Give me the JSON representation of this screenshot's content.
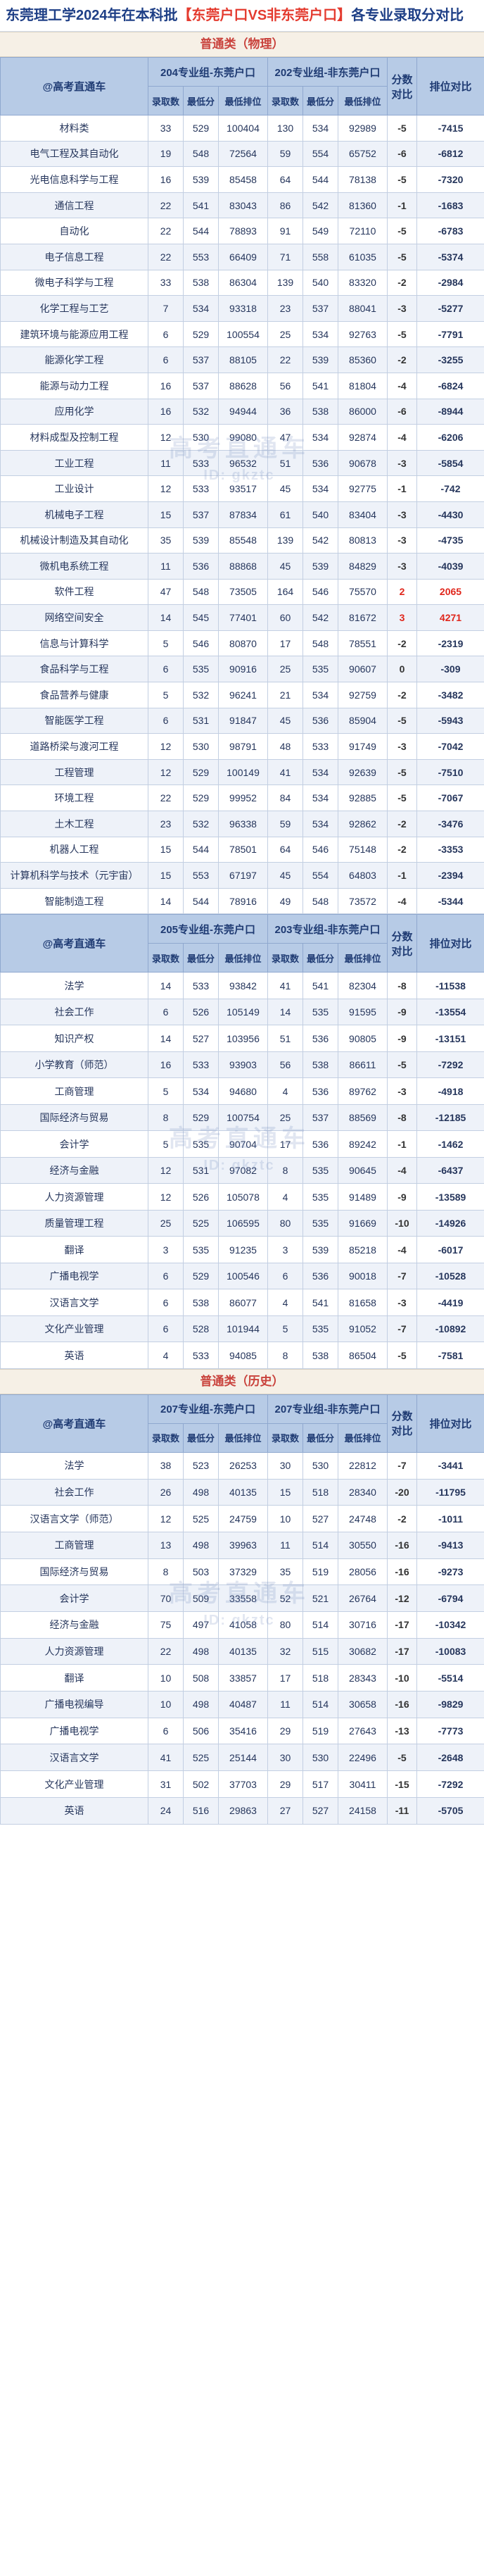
{
  "title": {
    "prefix": "东莞理工学2024年在本科批",
    "highlight": "【东莞户口VS非东莞户口】",
    "suffix": "各专业录取分对比"
  },
  "header_labels": {
    "author": "@高考直通车",
    "admit": "录取数",
    "min_score": "最低分",
    "min_rank": "最低排位",
    "score_diff": "分数对比",
    "rank_diff": "排位对比"
  },
  "watermark": {
    "text": "高考直通车",
    "sub": "ID: gkztc"
  },
  "sections": [
    {
      "title": "普通类（物理）",
      "group_dg": "204专业组-东莞户口",
      "group_ndg": "202专业组-非东莞户口",
      "rows": [
        {
          "name": "材料类",
          "a1": "33",
          "s1": "529",
          "r1": "100404",
          "a2": "130",
          "s2": "534",
          "r2": "92989",
          "d": "-5",
          "rd": "-7415"
        },
        {
          "name": "电气工程及其自动化",
          "a1": "19",
          "s1": "548",
          "r1": "72564",
          "a2": "59",
          "s2": "554",
          "r2": "65752",
          "d": "-6",
          "rd": "-6812"
        },
        {
          "name": "光电信息科学与工程",
          "a1": "16",
          "s1": "539",
          "r1": "85458",
          "a2": "64",
          "s2": "544",
          "r2": "78138",
          "d": "-5",
          "rd": "-7320"
        },
        {
          "name": "通信工程",
          "a1": "22",
          "s1": "541",
          "r1": "83043",
          "a2": "86",
          "s2": "542",
          "r2": "81360",
          "d": "-1",
          "rd": "-1683"
        },
        {
          "name": "自动化",
          "a1": "22",
          "s1": "544",
          "r1": "78893",
          "a2": "91",
          "s2": "549",
          "r2": "72110",
          "d": "-5",
          "rd": "-6783"
        },
        {
          "name": "电子信息工程",
          "a1": "22",
          "s1": "553",
          "r1": "66409",
          "a2": "71",
          "s2": "558",
          "r2": "61035",
          "d": "-5",
          "rd": "-5374"
        },
        {
          "name": "微电子科学与工程",
          "a1": "33",
          "s1": "538",
          "r1": "86304",
          "a2": "139",
          "s2": "540",
          "r2": "83320",
          "d": "-2",
          "rd": "-2984"
        },
        {
          "name": "化学工程与工艺",
          "a1": "7",
          "s1": "534",
          "r1": "93318",
          "a2": "23",
          "s2": "537",
          "r2": "88041",
          "d": "-3",
          "rd": "-5277"
        },
        {
          "name": "建筑环境与能源应用工程",
          "a1": "6",
          "s1": "529",
          "r1": "100554",
          "a2": "25",
          "s2": "534",
          "r2": "92763",
          "d": "-5",
          "rd": "-7791"
        },
        {
          "name": "能源化学工程",
          "a1": "6",
          "s1": "537",
          "r1": "88105",
          "a2": "22",
          "s2": "539",
          "r2": "85360",
          "d": "-2",
          "rd": "-3255"
        },
        {
          "name": "能源与动力工程",
          "a1": "16",
          "s1": "537",
          "r1": "88628",
          "a2": "56",
          "s2": "541",
          "r2": "81804",
          "d": "-4",
          "rd": "-6824"
        },
        {
          "name": "应用化学",
          "a1": "16",
          "s1": "532",
          "r1": "94944",
          "a2": "36",
          "s2": "538",
          "r2": "86000",
          "d": "-6",
          "rd": "-8944"
        },
        {
          "name": "材料成型及控制工程",
          "a1": "12",
          "s1": "530",
          "r1": "99080",
          "a2": "47",
          "s2": "534",
          "r2": "92874",
          "d": "-4",
          "rd": "-6206"
        },
        {
          "name": "工业工程",
          "a1": "11",
          "s1": "533",
          "r1": "96532",
          "a2": "51",
          "s2": "536",
          "r2": "90678",
          "d": "-3",
          "rd": "-5854"
        },
        {
          "name": "工业设计",
          "a1": "12",
          "s1": "533",
          "r1": "93517",
          "a2": "45",
          "s2": "534",
          "r2": "92775",
          "d": "-1",
          "rd": "-742"
        },
        {
          "name": "机械电子工程",
          "a1": "15",
          "s1": "537",
          "r1": "87834",
          "a2": "61",
          "s2": "540",
          "r2": "83404",
          "d": "-3",
          "rd": "-4430"
        },
        {
          "name": "机械设计制造及其自动化",
          "a1": "35",
          "s1": "539",
          "r1": "85548",
          "a2": "139",
          "s2": "542",
          "r2": "80813",
          "d": "-3",
          "rd": "-4735"
        },
        {
          "name": "微机电系统工程",
          "a1": "11",
          "s1": "536",
          "r1": "88868",
          "a2": "45",
          "s2": "539",
          "r2": "84829",
          "d": "-3",
          "rd": "-4039"
        },
        {
          "name": "软件工程",
          "a1": "47",
          "s1": "548",
          "r1": "73505",
          "a2": "164",
          "s2": "546",
          "r2": "75570",
          "d": "2",
          "rd": "2065"
        },
        {
          "name": "网络空间安全",
          "a1": "14",
          "s1": "545",
          "r1": "77401",
          "a2": "60",
          "s2": "542",
          "r2": "81672",
          "d": "3",
          "rd": "4271"
        },
        {
          "name": "信息与计算科学",
          "a1": "5",
          "s1": "546",
          "r1": "80870",
          "a2": "17",
          "s2": "548",
          "r2": "78551",
          "d": "-2",
          "rd": "-2319"
        },
        {
          "name": "食品科学与工程",
          "a1": "6",
          "s1": "535",
          "r1": "90916",
          "a2": "25",
          "s2": "535",
          "r2": "90607",
          "d": "0",
          "rd": "-309"
        },
        {
          "name": "食品营养与健康",
          "a1": "5",
          "s1": "532",
          "r1": "96241",
          "a2": "21",
          "s2": "534",
          "r2": "92759",
          "d": "-2",
          "rd": "-3482"
        },
        {
          "name": "智能医学工程",
          "a1": "6",
          "s1": "531",
          "r1": "91847",
          "a2": "45",
          "s2": "536",
          "r2": "85904",
          "d": "-5",
          "rd": "-5943"
        },
        {
          "name": "道路桥梁与渡河工程",
          "a1": "12",
          "s1": "530",
          "r1": "98791",
          "a2": "48",
          "s2": "533",
          "r2": "91749",
          "d": "-3",
          "rd": "-7042"
        },
        {
          "name": "工程管理",
          "a1": "12",
          "s1": "529",
          "r1": "100149",
          "a2": "41",
          "s2": "534",
          "r2": "92639",
          "d": "-5",
          "rd": "-7510"
        },
        {
          "name": "环境工程",
          "a1": "22",
          "s1": "529",
          "r1": "99952",
          "a2": "84",
          "s2": "534",
          "r2": "92885",
          "d": "-5",
          "rd": "-7067"
        },
        {
          "name": "土木工程",
          "a1": "23",
          "s1": "532",
          "r1": "96338",
          "a2": "59",
          "s2": "534",
          "r2": "92862",
          "d": "-2",
          "rd": "-3476"
        },
        {
          "name": "机器人工程",
          "a1": "15",
          "s1": "544",
          "r1": "78501",
          "a2": "64",
          "s2": "546",
          "r2": "75148",
          "d": "-2",
          "rd": "-3353"
        },
        {
          "name": "计算机科学与技术（元宇宙）",
          "a1": "15",
          "s1": "553",
          "r1": "67197",
          "a2": "45",
          "s2": "554",
          "r2": "64803",
          "d": "-1",
          "rd": "-2394"
        },
        {
          "name": "智能制造工程",
          "a1": "14",
          "s1": "544",
          "r1": "78916",
          "a2": "49",
          "s2": "548",
          "r2": "73572",
          "d": "-4",
          "rd": "-5344"
        }
      ]
    },
    {
      "title": "",
      "group_dg": "205专业组-东莞户口",
      "group_ndg": "203专业组-非东莞户口",
      "rows": [
        {
          "name": "法学",
          "a1": "14",
          "s1": "533",
          "r1": "93842",
          "a2": "41",
          "s2": "541",
          "r2": "82304",
          "d": "-8",
          "rd": "-11538"
        },
        {
          "name": "社会工作",
          "a1": "6",
          "s1": "526",
          "r1": "105149",
          "a2": "14",
          "s2": "535",
          "r2": "91595",
          "d": "-9",
          "rd": "-13554"
        },
        {
          "name": "知识产权",
          "a1": "14",
          "s1": "527",
          "r1": "103956",
          "a2": "51",
          "s2": "536",
          "r2": "90805",
          "d": "-9",
          "rd": "-13151"
        },
        {
          "name": "小学教育（师范）",
          "a1": "16",
          "s1": "533",
          "r1": "93903",
          "a2": "56",
          "s2": "538",
          "r2": "86611",
          "d": "-5",
          "rd": "-7292"
        },
        {
          "name": "工商管理",
          "a1": "5",
          "s1": "534",
          "r1": "94680",
          "a2": "4",
          "s2": "536",
          "r2": "89762",
          "d": "-3",
          "rd": "-4918"
        },
        {
          "name": "国际经济与贸易",
          "a1": "8",
          "s1": "529",
          "r1": "100754",
          "a2": "25",
          "s2": "537",
          "r2": "88569",
          "d": "-8",
          "rd": "-12185"
        },
        {
          "name": "会计学",
          "a1": "5",
          "s1": "535",
          "r1": "90704",
          "a2": "17",
          "s2": "536",
          "r2": "89242",
          "d": "-1",
          "rd": "-1462"
        },
        {
          "name": "经济与金融",
          "a1": "12",
          "s1": "531",
          "r1": "97082",
          "a2": "8",
          "s2": "535",
          "r2": "90645",
          "d": "-4",
          "rd": "-6437"
        },
        {
          "name": "人力资源管理",
          "a1": "12",
          "s1": "526",
          "r1": "105078",
          "a2": "4",
          "s2": "535",
          "r2": "91489",
          "d": "-9",
          "rd": "-13589"
        },
        {
          "name": "质量管理工程",
          "a1": "25",
          "s1": "525",
          "r1": "106595",
          "a2": "80",
          "s2": "535",
          "r2": "91669",
          "d": "-10",
          "rd": "-14926"
        },
        {
          "name": "翻译",
          "a1": "3",
          "s1": "535",
          "r1": "91235",
          "a2": "3",
          "s2": "539",
          "r2": "85218",
          "d": "-4",
          "rd": "-6017"
        },
        {
          "name": "广播电视学",
          "a1": "6",
          "s1": "529",
          "r1": "100546",
          "a2": "6",
          "s2": "536",
          "r2": "90018",
          "d": "-7",
          "rd": "-10528"
        },
        {
          "name": "汉语言文学",
          "a1": "6",
          "s1": "538",
          "r1": "86077",
          "a2": "4",
          "s2": "541",
          "r2": "81658",
          "d": "-3",
          "rd": "-4419"
        },
        {
          "name": "文化产业管理",
          "a1": "6",
          "s1": "528",
          "r1": "101944",
          "a2": "5",
          "s2": "535",
          "r2": "91052",
          "d": "-7",
          "rd": "-10892"
        },
        {
          "name": "英语",
          "a1": "4",
          "s1": "533",
          "r1": "94085",
          "a2": "8",
          "s2": "538",
          "r2": "86504",
          "d": "-5",
          "rd": "-7581"
        }
      ]
    },
    {
      "title": "普通类（历史）",
      "group_dg": "207专业组-东莞户口",
      "group_ndg": "207专业组-非东莞户口",
      "rows": [
        {
          "name": "法学",
          "a1": "38",
          "s1": "523",
          "r1": "26253",
          "a2": "30",
          "s2": "530",
          "r2": "22812",
          "d": "-7",
          "rd": "-3441"
        },
        {
          "name": "社会工作",
          "a1": "26",
          "s1": "498",
          "r1": "40135",
          "a2": "15",
          "s2": "518",
          "r2": "28340",
          "d": "-20",
          "rd": "-11795"
        },
        {
          "name": "汉语言文学（师范）",
          "a1": "12",
          "s1": "525",
          "r1": "24759",
          "a2": "10",
          "s2": "527",
          "r2": "24748",
          "d": "-2",
          "rd": "-1011"
        },
        {
          "name": "工商管理",
          "a1": "13",
          "s1": "498",
          "r1": "39963",
          "a2": "11",
          "s2": "514",
          "r2": "30550",
          "d": "-16",
          "rd": "-9413"
        },
        {
          "name": "国际经济与贸易",
          "a1": "8",
          "s1": "503",
          "r1": "37329",
          "a2": "35",
          "s2": "519",
          "r2": "28056",
          "d": "-16",
          "rd": "-9273"
        },
        {
          "name": "会计学",
          "a1": "70",
          "s1": "509",
          "r1": "33558",
          "a2": "52",
          "s2": "521",
          "r2": "26764",
          "d": "-12",
          "rd": "-6794"
        },
        {
          "name": "经济与金融",
          "a1": "75",
          "s1": "497",
          "r1": "41058",
          "a2": "80",
          "s2": "514",
          "r2": "30716",
          "d": "-17",
          "rd": "-10342"
        },
        {
          "name": "人力资源管理",
          "a1": "22",
          "s1": "498",
          "r1": "40135",
          "a2": "32",
          "s2": "515",
          "r2": "30682",
          "d": "-17",
          "rd": "-10083"
        },
        {
          "name": "翻译",
          "a1": "10",
          "s1": "508",
          "r1": "33857",
          "a2": "17",
          "s2": "518",
          "r2": "28343",
          "d": "-10",
          "rd": "-5514"
        },
        {
          "name": "广播电视编导",
          "a1": "10",
          "s1": "498",
          "r1": "40487",
          "a2": "11",
          "s2": "514",
          "r2": "30658",
          "d": "-16",
          "rd": "-9829"
        },
        {
          "name": "广播电视学",
          "a1": "6",
          "s1": "506",
          "r1": "35416",
          "a2": "29",
          "s2": "519",
          "r2": "27643",
          "d": "-13",
          "rd": "-7773"
        },
        {
          "name": "汉语言文学",
          "a1": "41",
          "s1": "525",
          "r1": "25144",
          "a2": "30",
          "s2": "530",
          "r2": "22496",
          "d": "-5",
          "rd": "-2648"
        },
        {
          "name": "文化产业管理",
          "a1": "31",
          "s1": "502",
          "r1": "37703",
          "a2": "29",
          "s2": "517",
          "r2": "30411",
          "d": "-15",
          "rd": "-7292"
        },
        {
          "name": "英语",
          "a1": "24",
          "s1": "516",
          "r1": "29863",
          "a2": "27",
          "s2": "527",
          "r2": "24158",
          "d": "-11",
          "rd": "-5705"
        }
      ]
    }
  ]
}
